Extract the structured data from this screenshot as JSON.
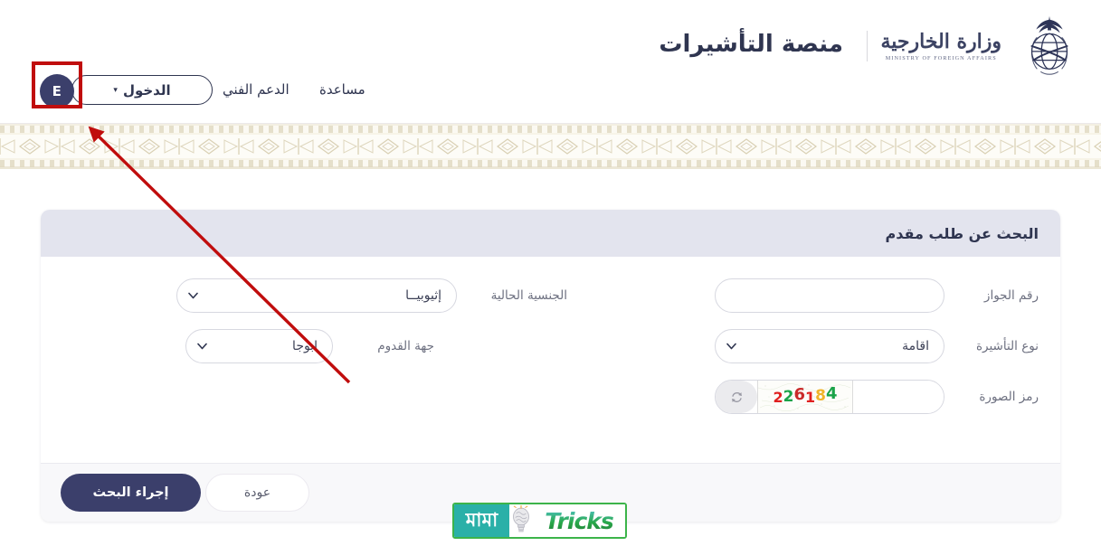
{
  "header": {
    "platform_title": "منصة التأشيرات",
    "ministry_name_ar": "وزارة الخارجية",
    "ministry_name_en": "MINISTRY OF FOREIGN AFFAIRS",
    "emblem_icon": "saudi-emblem-palm-swords-icon",
    "avatar_initial": "E",
    "login_label": "الدخول",
    "login_caret_icon": "chevron-down-icon",
    "nav": [
      {
        "label": "الدعم الفني",
        "name": "nav-technical-support"
      },
      {
        "label": "مساعدة",
        "name": "nav-help"
      }
    ]
  },
  "annotation": {
    "box_color": "#c00d0d",
    "arrow_color": "#c00d0d",
    "arrow_target": "avatar"
  },
  "panel": {
    "title": "البحث عن طلب مقدم",
    "header_bg": "#e3e4ee",
    "fields": {
      "passport": {
        "label": "رقم الجواز",
        "value": "",
        "placeholder": ""
      },
      "visa_type": {
        "label": "نوع التأشيرة",
        "value": "اقامة",
        "chevron_icon": "chevron-down-icon"
      },
      "nationality": {
        "label": "الجنسية الحالية",
        "value": "إثيوبيــا",
        "chevron_icon": "chevron-down-icon"
      },
      "arrival_point": {
        "label": "جهة القدوم",
        "value": "ابوجا",
        "chevron_icon": "chevron-down-icon"
      },
      "captcha": {
        "label": "رمز الصورة",
        "code": "226184",
        "code_digits": [
          {
            "ch": "2",
            "color": "#e02020"
          },
          {
            "ch": "2",
            "color": "#1aa349"
          },
          {
            "ch": "6",
            "color": "#c92a2a"
          },
          {
            "ch": "1",
            "color": "#e02020"
          },
          {
            "ch": "8",
            "color": "#f0b429"
          },
          {
            "ch": "4",
            "color": "#1aa349"
          }
        ],
        "refresh_icon": "refresh-icon",
        "input_value": ""
      }
    },
    "buttons": {
      "search": "إجراء البحث",
      "back": "عودة"
    },
    "colors": {
      "primary": "#3b3f6b",
      "text": "#2f3550",
      "label": "#6d7080",
      "footer_bg": "#f8f8fa"
    }
  },
  "watermark": {
    "text_left": "Tricks",
    "text_right": "মামা",
    "bulb_icon": "lightbulb-brain-icon",
    "border_color": "#3cb44a",
    "right_bg": "#2ab0a8"
  }
}
